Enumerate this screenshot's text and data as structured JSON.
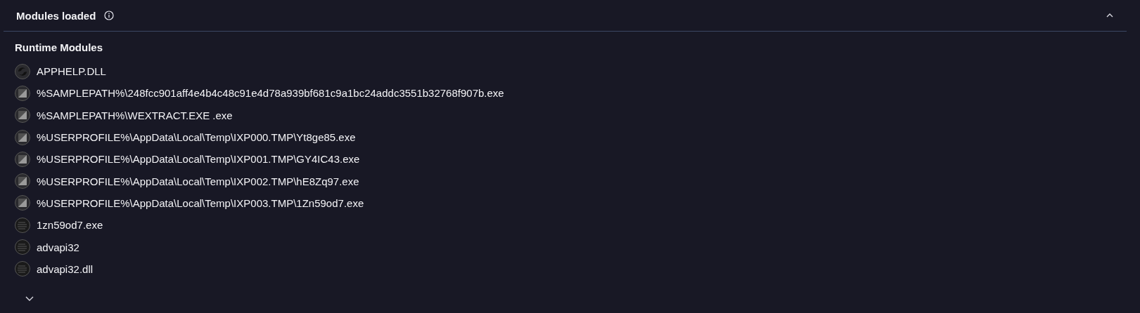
{
  "panel": {
    "title": "Modules loaded",
    "expanded": true
  },
  "section": {
    "title": "Runtime Modules"
  },
  "modules": [
    {
      "name": "APPHELP.DLL",
      "kind": "system"
    },
    {
      "name": "%SAMPLEPATH%\\248fcc901aff4e4b4c48c91e4d78a939bf681c9a1bc24addc3551b32768f907b.exe",
      "kind": "executable"
    },
    {
      "name": "%SAMPLEPATH%\\WEXTRACT.EXE .exe",
      "kind": "executable"
    },
    {
      "name": "%USERPROFILE%\\AppData\\Local\\Temp\\IXP000.TMP\\Yt8ge85.exe",
      "kind": "executable"
    },
    {
      "name": "%USERPROFILE%\\AppData\\Local\\Temp\\IXP001.TMP\\GY4IC43.exe",
      "kind": "executable"
    },
    {
      "name": "%USERPROFILE%\\AppData\\Local\\Temp\\IXP002.TMP\\hE8Zq97.exe",
      "kind": "executable"
    },
    {
      "name": "%USERPROFILE%\\AppData\\Local\\Temp\\IXP003.TMP\\1Zn59od7.exe",
      "kind": "executable"
    },
    {
      "name": "1zn59od7.exe",
      "kind": "library"
    },
    {
      "name": "advapi32",
      "kind": "library"
    },
    {
      "name": "advapi32.dll",
      "kind": "library"
    }
  ],
  "show_more": {
    "expanded": false
  }
}
